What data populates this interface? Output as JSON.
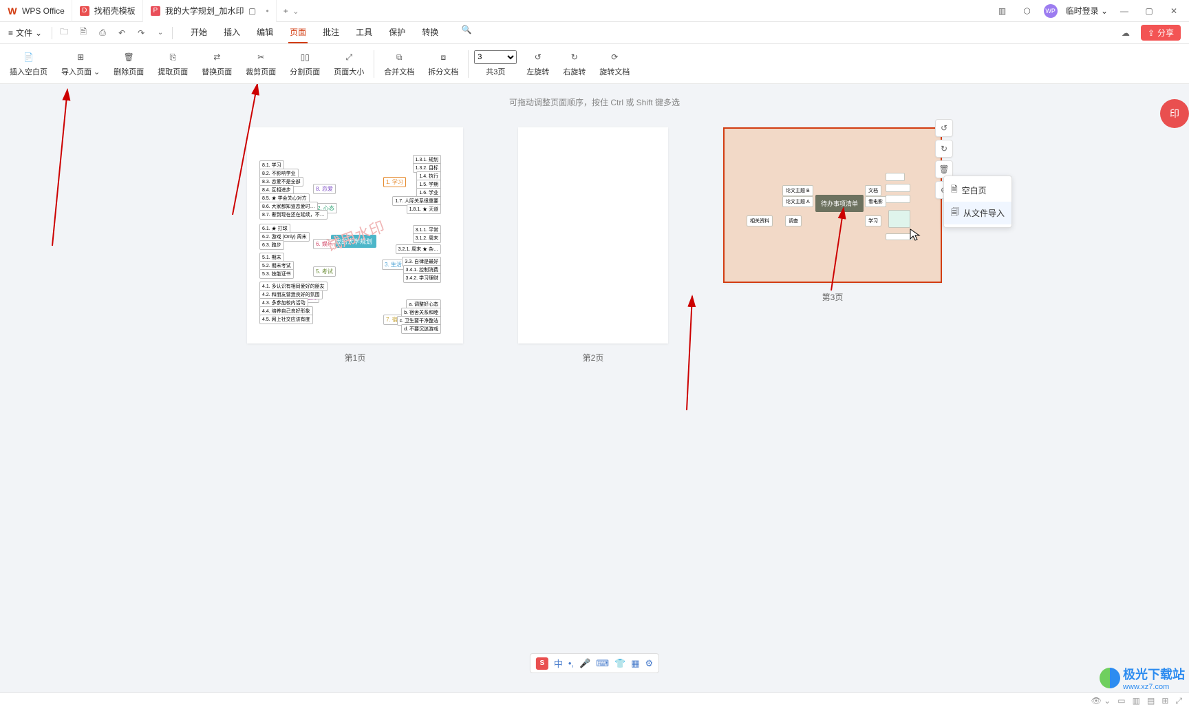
{
  "tabs": {
    "app": "WPS Office",
    "template": "找稻壳模板",
    "doc": "我的大学规划_加水印",
    "new": "+"
  },
  "user": {
    "login": "临时登录"
  },
  "menu": {
    "file": "文件",
    "tabs": [
      "开始",
      "插入",
      "编辑",
      "页面",
      "批注",
      "工具",
      "保护",
      "转换"
    ],
    "active_index": 3,
    "share": "分享"
  },
  "ribbon": {
    "insert_blank": "插入空白页",
    "import_page": "导入页面",
    "delete_page": "删除页面",
    "extract_page": "提取页面",
    "replace_page": "替换页面",
    "crop_page": "裁剪页面",
    "split_page": "分割页面",
    "page_size": "页面大小",
    "merge_doc": "合并文档",
    "split_doc": "拆分文档",
    "page_sel_value": "3",
    "page_total": "共3页",
    "rotate_left": "左旋转",
    "rotate_right": "右旋转",
    "rotate_doc": "旋转文档"
  },
  "hint": "可拖动调整页面顺序，按住 Ctrl 或 Shift 键多选",
  "pages": {
    "p1": "第1页",
    "p2": "第2页",
    "p3": "第3页"
  },
  "popup": {
    "blank": "空白页",
    "from_file": "从文件导入"
  },
  "mindmap": {
    "center": "我的大学规划",
    "watermark": "试用水印",
    "cats": [
      "1. 学习",
      "2. 心态",
      "3. 生活",
      "4. 社交",
      "5. 考试",
      "6. 娱乐",
      "7. 宿舍",
      "8. 恋爱"
    ]
  },
  "todo": {
    "center": "待办事项清单",
    "left_b1": "论文主题 B",
    "left_b2": "论文主题 A",
    "left_b3": "调查",
    "left_far": "相关资料",
    "right_t1": "文档",
    "right_t2": "看电影",
    "right_t3": "学习",
    "footer": ""
  },
  "ime": {
    "label": "中"
  },
  "branding": {
    "name": "极光下载站",
    "url": "www.xz7.com"
  },
  "watermark_badge": "印"
}
